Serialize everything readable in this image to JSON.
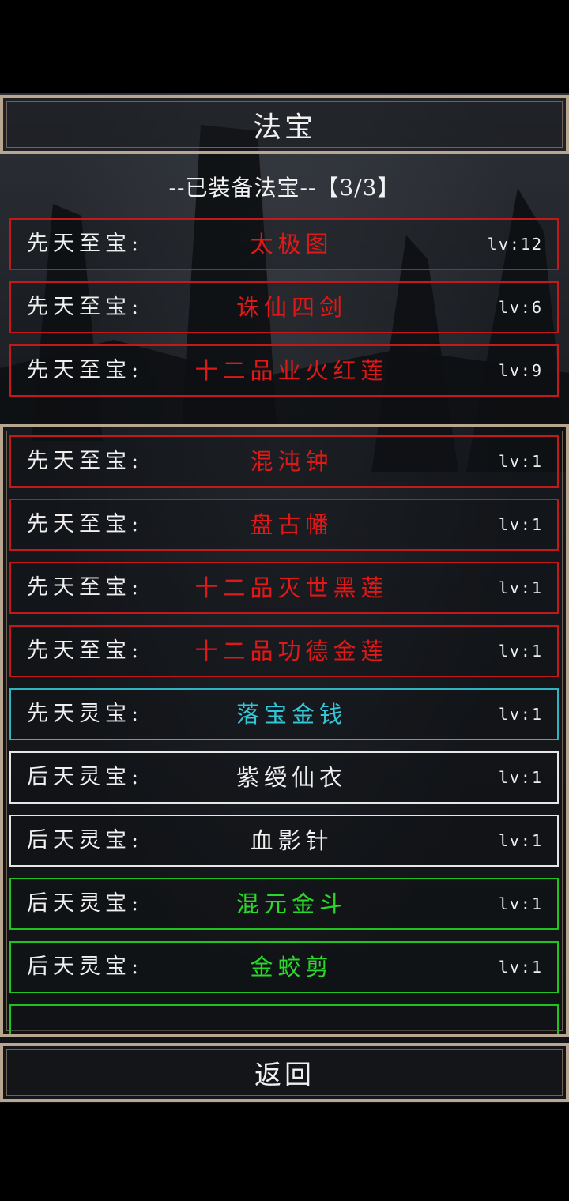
{
  "title": "法宝",
  "equipped_header": "--已装备法宝--【3/3】",
  "equipped": [
    {
      "category": "先天至宝:",
      "name": "太极图",
      "level": "lv:12",
      "rarity": "red"
    },
    {
      "category": "先天至宝:",
      "name": "诛仙四剑",
      "level": "lv:6",
      "rarity": "red"
    },
    {
      "category": "先天至宝:",
      "name": "十二品业火红莲",
      "level": "lv:9",
      "rarity": "red"
    }
  ],
  "inventory": [
    {
      "category": "先天至宝:",
      "name": "混沌钟",
      "level": "lv:1",
      "rarity": "red"
    },
    {
      "category": "先天至宝:",
      "name": "盘古幡",
      "level": "lv:1",
      "rarity": "red"
    },
    {
      "category": "先天至宝:",
      "name": "十二品灭世黑莲",
      "level": "lv:1",
      "rarity": "red"
    },
    {
      "category": "先天至宝:",
      "name": "十二品功德金莲",
      "level": "lv:1",
      "rarity": "red"
    },
    {
      "category": "先天灵宝:",
      "name": "落宝金钱",
      "level": "lv:1",
      "rarity": "cyan"
    },
    {
      "category": "后天灵宝:",
      "name": "紫绶仙衣",
      "level": "lv:1",
      "rarity": "white"
    },
    {
      "category": "后天灵宝:",
      "name": "血影针",
      "level": "lv:1",
      "rarity": "white"
    },
    {
      "category": "后天灵宝:",
      "name": "混元金斗",
      "level": "lv:1",
      "rarity": "green"
    },
    {
      "category": "后天灵宝:",
      "name": "金蛟剪",
      "level": "lv:1",
      "rarity": "green"
    }
  ],
  "back_button": "返回",
  "colors": {
    "frame": "#b8a690",
    "red": "#e01818",
    "cyan": "#33c6d6",
    "white": "#f0f0f0",
    "green": "#2ad82a"
  }
}
